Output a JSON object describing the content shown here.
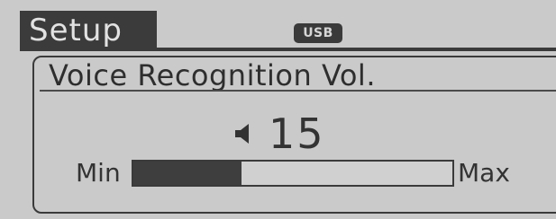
{
  "header": {
    "tab_label": "Setup",
    "source_badge": "USB"
  },
  "panel": {
    "title": "Voice Recognition Vol.",
    "volume_icon": "speaker-icon",
    "volume_value": "15",
    "min_label": "Min",
    "max_label": "Max",
    "volume_fill_fraction": 0.34
  },
  "colors": {
    "background": "#cacaca",
    "dark": "#3b3b3b",
    "text": "#333333"
  }
}
